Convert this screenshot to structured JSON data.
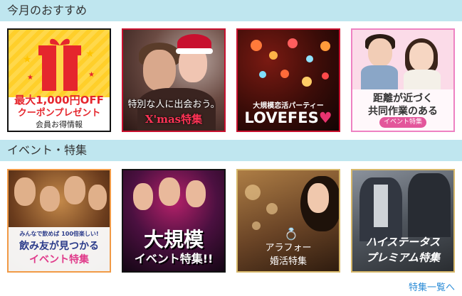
{
  "sections": {
    "monthly": {
      "title": "今月のおすすめ"
    },
    "events": {
      "title": "イベント・特集"
    }
  },
  "cards": {
    "coupon": {
      "line1": "最大1,000円OFF",
      "line2": "クーポンプレゼント",
      "line3": "会員お得情報"
    },
    "xmas": {
      "line1": "特別な人に出会おう。",
      "line2": "X'mas特集"
    },
    "lovefes": {
      "line1": "大規模恋活パーティー",
      "line2": "LOVEFES",
      "heart": "♥"
    },
    "cooperation": {
      "line1": "距離が近づく",
      "line2": "共同作業のある",
      "tag": "イベント特集"
    },
    "drinking": {
      "line1": "みんなで飲めば 100倍楽しい!",
      "line2": "飲み友が見つかる",
      "line3": "イベント特集"
    },
    "big_event": {
      "line1": "大規模",
      "line2": "イベント特集!!"
    },
    "arafo": {
      "line1": "アラフォー",
      "line2": "婚活特集",
      "ring": "💍"
    },
    "high_status": {
      "line1": "ハイステータス",
      "line2": "プレミアム特集"
    }
  },
  "footer": {
    "link_label": "特集一覧へ"
  }
}
